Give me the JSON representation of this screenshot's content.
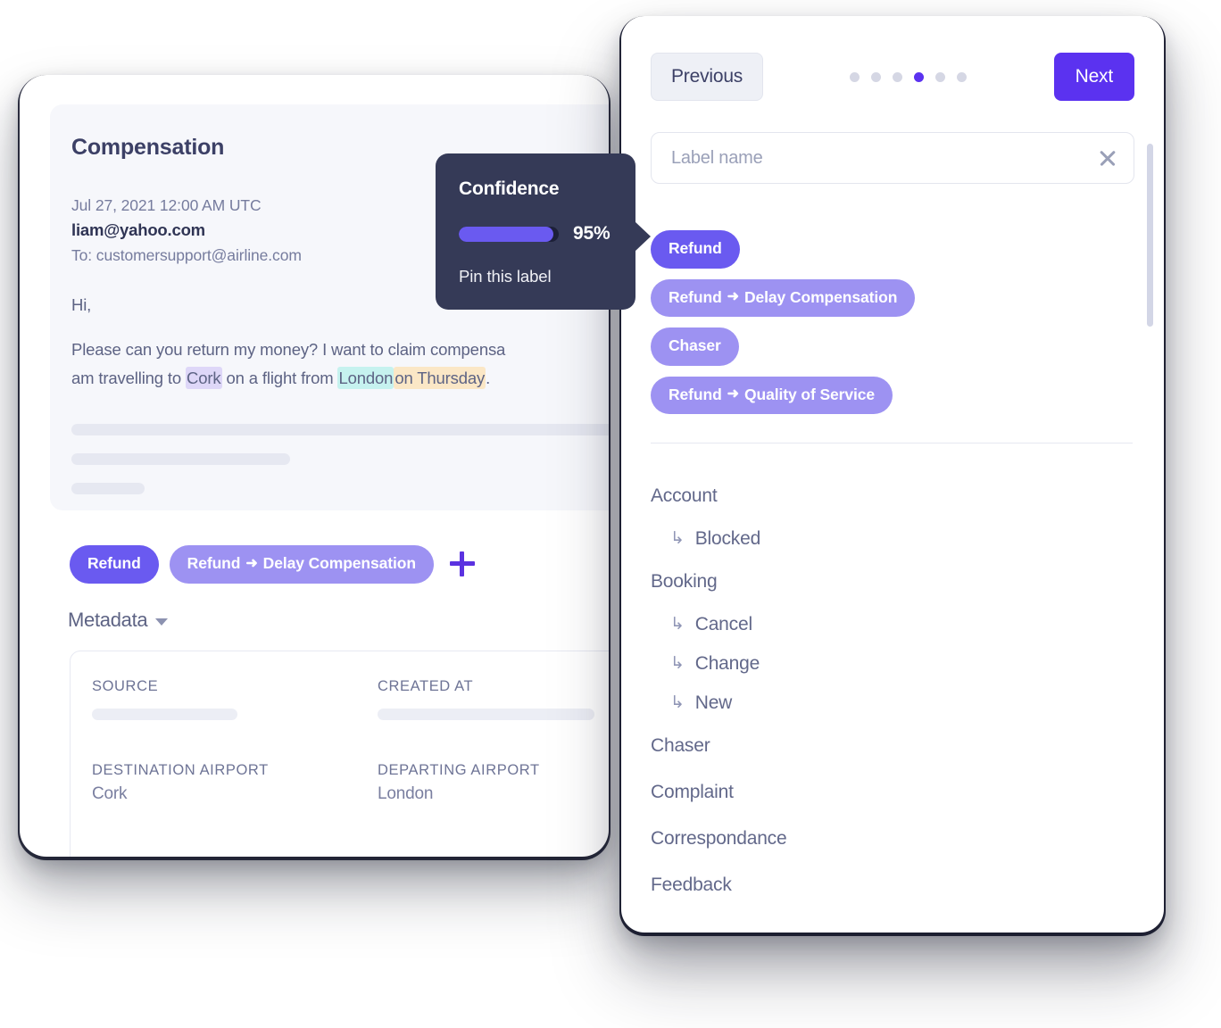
{
  "email": {
    "subject": "Compensation",
    "date": "Jul 27, 2021 12:00 AM UTC",
    "from": "liam@yahoo.com",
    "to": "To: customersupport@airline.com",
    "greeting": "Hi,",
    "body_line1_a": "Please can you return my money? I want to claim compensa",
    "body_line2_a": "am travelling to ",
    "body_line2_hl1": "Cork",
    "body_line2_b": " on a flight from ",
    "body_line2_hl2": "London",
    "body_line2_hl3": "on Thursday",
    "body_line2_c": "."
  },
  "tags": {
    "items": [
      {
        "label": "Refund",
        "style": "strong"
      },
      {
        "label": "Refund",
        "arrow": "➜",
        "label2": "Delay Compensation",
        "style": "soft"
      }
    ],
    "add_icon": "plus-icon"
  },
  "metadata": {
    "toggle_label": "Metadata",
    "fields": [
      {
        "key": "SOURCE",
        "value": "",
        "skeleton": true
      },
      {
        "key": "CREATED AT",
        "value": "",
        "skeleton": true
      },
      {
        "key": "DESTINATION AIRPORT",
        "value": "Cork",
        "skeleton": false
      },
      {
        "key": "DEPARTING AIRPORT",
        "value": "London",
        "skeleton": false
      }
    ]
  },
  "confidence_tooltip": {
    "title": "Confidence",
    "percent": 95,
    "percent_text": "95%",
    "pin_action": "Pin this label",
    "bg_color": "#353a57",
    "fill_color": "#6a5af0"
  },
  "pager": {
    "previous_label": "Previous",
    "next_label": "Next",
    "dots_total": 6,
    "dots_active_index": 3
  },
  "label_search": {
    "placeholder": "Label name",
    "value": "",
    "clear_icon": "close-icon"
  },
  "suggested_labels": [
    {
      "label": "Refund",
      "style": "strong"
    },
    {
      "label": "Refund",
      "arrow": "➜",
      "label2": "Delay Compensation",
      "style": "soft"
    },
    {
      "label": "Chaser",
      "style": "soft"
    },
    {
      "label": "Refund",
      "arrow": "➜",
      "label2": "Quality of Service",
      "style": "soft"
    }
  ],
  "label_tree": [
    {
      "type": "group",
      "label": "Account"
    },
    {
      "type": "child",
      "label": "Blocked",
      "icon": "↳"
    },
    {
      "type": "group",
      "label": "Booking"
    },
    {
      "type": "child",
      "label": "Cancel",
      "icon": "↳"
    },
    {
      "type": "child",
      "label": "Change",
      "icon": "↳"
    },
    {
      "type": "child",
      "label": "New",
      "icon": "↳"
    },
    {
      "type": "group",
      "label": "Chaser"
    },
    {
      "type": "group",
      "label": "Complaint"
    },
    {
      "type": "group",
      "label": "Correspondance"
    },
    {
      "type": "group",
      "label": "Feedback"
    }
  ],
  "colors": {
    "accent": "#5b32f0",
    "pill_strong": "#6a5af0",
    "pill_soft": "#9d92f2",
    "highlight_purple": "#ded7f8",
    "highlight_cyan": "#c6f2ef",
    "highlight_peach": "#fbe7c6"
  }
}
